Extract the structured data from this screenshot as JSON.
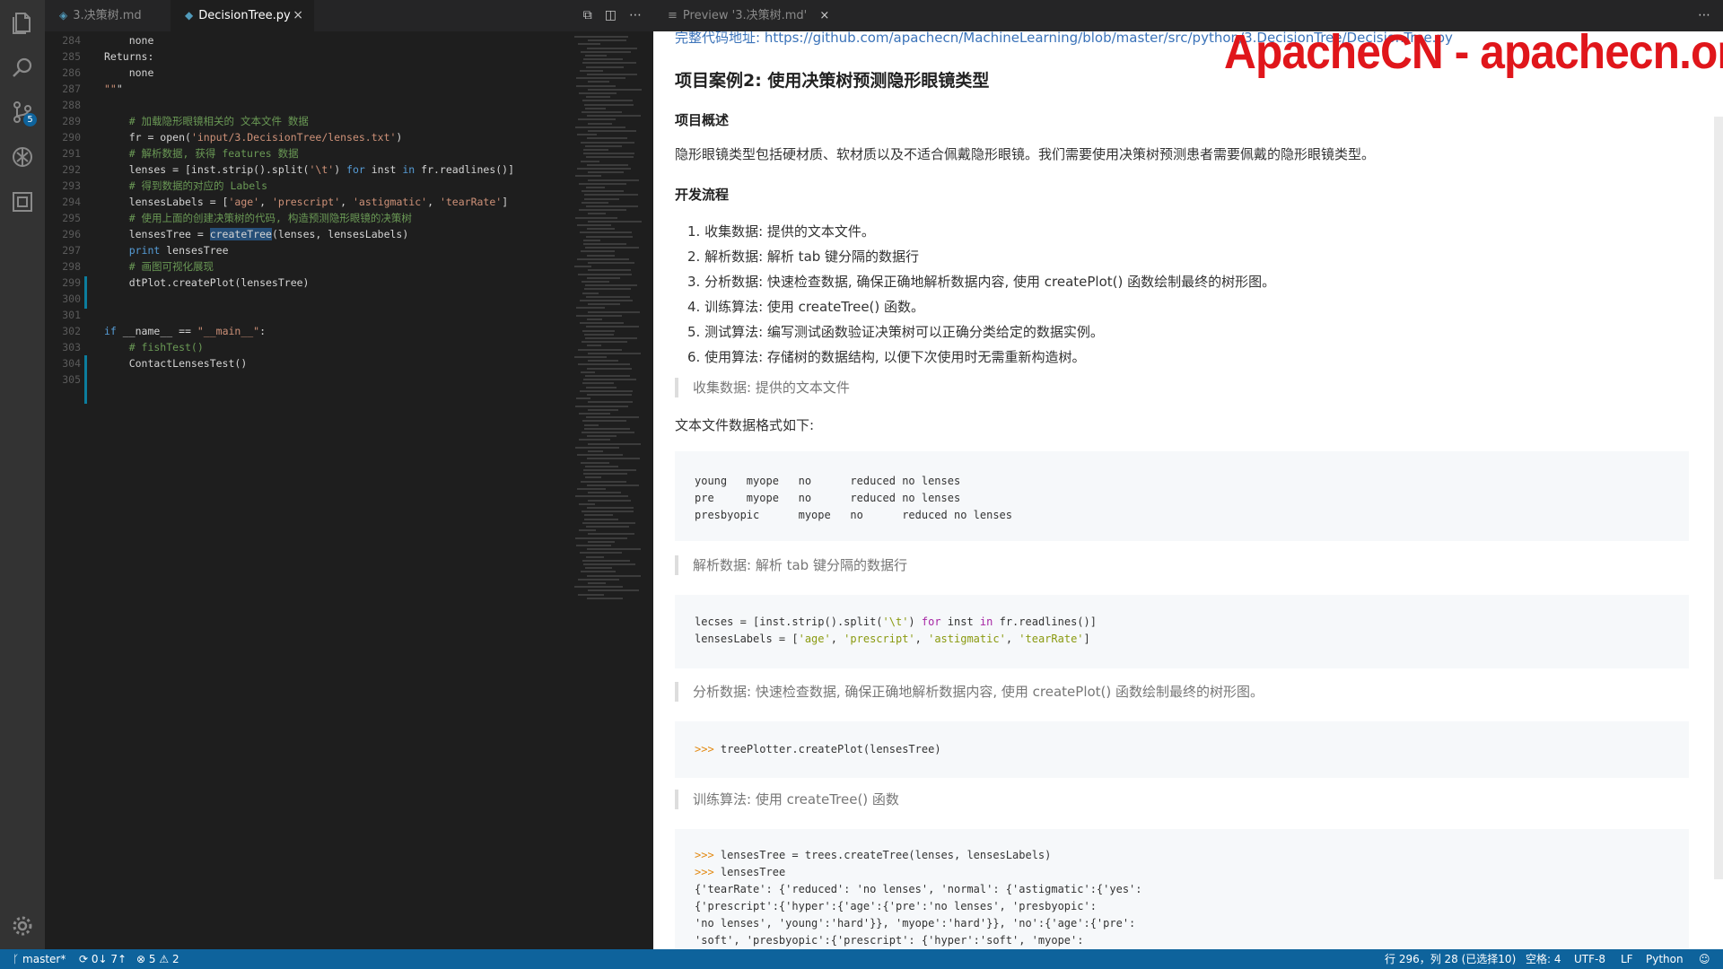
{
  "editor": {
    "tabs": [
      {
        "label": "3.决策树.md",
        "active": false
      },
      {
        "label": "DecisionTree.py",
        "active": true
      }
    ],
    "close_icon": "×",
    "lines": [
      {
        "n": "284",
        "text": "    none"
      },
      {
        "n": "285",
        "text": "Returns:"
      },
      {
        "n": "286",
        "text": "    none"
      },
      {
        "n": "287",
        "text": "\"\"\""
      },
      {
        "n": "288",
        "text": ""
      },
      {
        "n": "289",
        "text": "# 加载隐形眼镜相关的 文本文件 数据"
      },
      {
        "n": "290",
        "text": "fr = open('input/3.DecisionTree/lenses.txt')"
      },
      {
        "n": "291",
        "text": "# 解析数据, 获得 features 数据"
      },
      {
        "n": "292",
        "text": "lenses = [inst.strip().split('\\t') for inst in fr.readlines()]"
      },
      {
        "n": "293",
        "text": "# 得到数据的对应的 Labels"
      },
      {
        "n": "294",
        "text": "lensesLabels = ['age', 'prescript', 'astigmatic', 'tearRate']"
      },
      {
        "n": "295",
        "text": "# 使用上面的创建决策树的代码, 构造预测隐形眼镜的决策树"
      },
      {
        "n": "296",
        "text": "lensesTree = createTree(lenses, lensesLabels)"
      },
      {
        "n": "297",
        "text": "print lensesTree"
      },
      {
        "n": "298",
        "text": "# 画图可视化展现"
      },
      {
        "n": "299",
        "text": "dtPlot.createPlot(lensesTree)"
      },
      {
        "n": "300",
        "text": ""
      },
      {
        "n": "301",
        "text": ""
      },
      {
        "n": "302",
        "text": "if __name__ == \"__main__\":"
      },
      {
        "n": "303",
        "text": "    # fishTest()"
      },
      {
        "n": "304",
        "text": "    ContactLensesTest()"
      },
      {
        "n": "305",
        "text": ""
      }
    ]
  },
  "preview": {
    "tab_label": "Preview '3.决策树.md'",
    "link_text": "完整代码地址: https://github.com/apachecn/MachineLearning/blob/master/src/python/3.DecisionTree/DecisionTree.py",
    "watermark": "ApacheCN - apachecn.org",
    "heading": "项目案例2: 使用决策树预测隐形眼镜类型",
    "overview_title": "项目概述",
    "overview_text": "隐形眼镜类型包括硬材质、软材质以及不适合佩戴隐形眼镜。我们需要使用决策树预测患者需要佩戴的隐形眼镜类型。",
    "flow_title": "开发流程",
    "steps": [
      "收集数据: 提供的文本文件。",
      "解析数据: 解析 tab 键分隔的数据行",
      "分析数据: 快速检查数据, 确保正确地解析数据内容, 使用 createPlot() 函数绘制最终的树形图。",
      "训练算法: 使用 createTree() 函数。",
      "测试算法: 编写测试函数验证决策树可以正确分类给定的数据实例。",
      "使用算法: 存储树的数据结构, 以便下次使用时无需重新构造树。"
    ],
    "quote1": "收集数据: 提供的文本文件",
    "format_label": "文本文件数据格式如下:",
    "data_lines": [
      "young   myope   no      reduced no lenses",
      "pre     myope   no      reduced no lenses",
      "presbyopic      myope   no      reduced no lenses"
    ],
    "quote2": "解析数据: 解析 tab 键分隔的数据行",
    "parse_code": {
      "line1_a": "lecses = [inst.strip().split(",
      "line1_str": "'\\t'",
      "line1_b": ") ",
      "line1_kw1": "for",
      "line1_c": " inst ",
      "line1_kw2": "in",
      "line1_d": " fr.readlines()]",
      "line2_a": "lensesLabels = [",
      "labels": [
        "'age'",
        "'prescript'",
        "'astigmatic'",
        "'tearRate'"
      ],
      "line2_end": "]"
    },
    "quote3": "分析数据: 快速检查数据, 确保正确地解析数据内容, 使用 createPlot() 函数绘制最终的树形图。",
    "prompt": ">>>",
    "plot_code": "treePlotter.createPlot(lensesTree)",
    "quote4": "训练算法: 使用 createTree() 函数",
    "train_code": {
      "l1": "lensesTree = trees.createTree(lenses, lensesLabels)",
      "l2": "lensesTree",
      "out": [
        "{'tearRate': {'reduced': 'no lenses', 'normal': {'astigmatic':{'yes':",
        "{'prescript':{'hyper':{'age':{'pre':'no lenses', 'presbyopic':",
        "'no lenses', 'young':'hard'}}, 'myope':'hard'}}, 'no':{'age':{'pre':",
        "'soft', 'presbyopic':{'prescript': {'hyper':'soft', 'myope':"
      ]
    }
  },
  "statusbar": {
    "branch": "master*",
    "sync": "0↓ 7↑",
    "errors": "5",
    "warnings": "2",
    "position": "行 296，列 28 (已选择10)",
    "spaces": "空格: 4",
    "encoding": "UTF-8",
    "eol": "LF",
    "language": "Python"
  },
  "activity": {
    "icons": [
      "files-icon",
      "search-icon",
      "source-control-icon",
      "debug-icon",
      "extensions-icon",
      "settings-gear-icon"
    ],
    "scm_badge": "5"
  }
}
